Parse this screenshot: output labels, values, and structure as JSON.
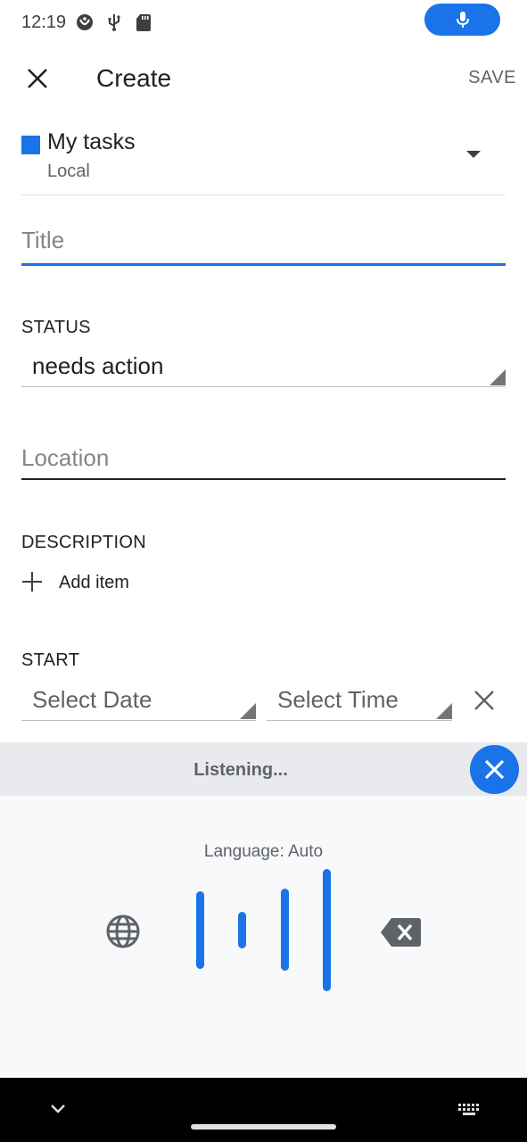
{
  "status_bar": {
    "time": "12:19",
    "icons": [
      "notification-app-icon",
      "usb-icon",
      "sd-card-icon"
    ],
    "voice_indicator_icon": "mic-icon"
  },
  "app_bar": {
    "close_icon": "close-icon",
    "title": "Create",
    "save_label": "SAVE"
  },
  "task_list": {
    "name": "My tasks",
    "account": "Local",
    "color": "#1a73e8",
    "dropdown_icon": "arrow-drop-down-icon"
  },
  "form": {
    "title_placeholder": "Title",
    "status_label": "STATUS",
    "status_value": "needs action",
    "location_placeholder": "Location",
    "description_label": "DESCRIPTION",
    "add_item_label": "Add item",
    "start_label": "START",
    "start_date_placeholder": "Select Date",
    "start_time_placeholder": "Select Time"
  },
  "voice_input": {
    "status": "Listening...",
    "language": "Language: Auto",
    "accent_color": "#1a73e8",
    "icons": [
      "globe-icon",
      "backspace-icon",
      "close-icon"
    ]
  },
  "nav_bar": {
    "icons": [
      "chevron-down-icon",
      "keyboard-icon"
    ]
  }
}
